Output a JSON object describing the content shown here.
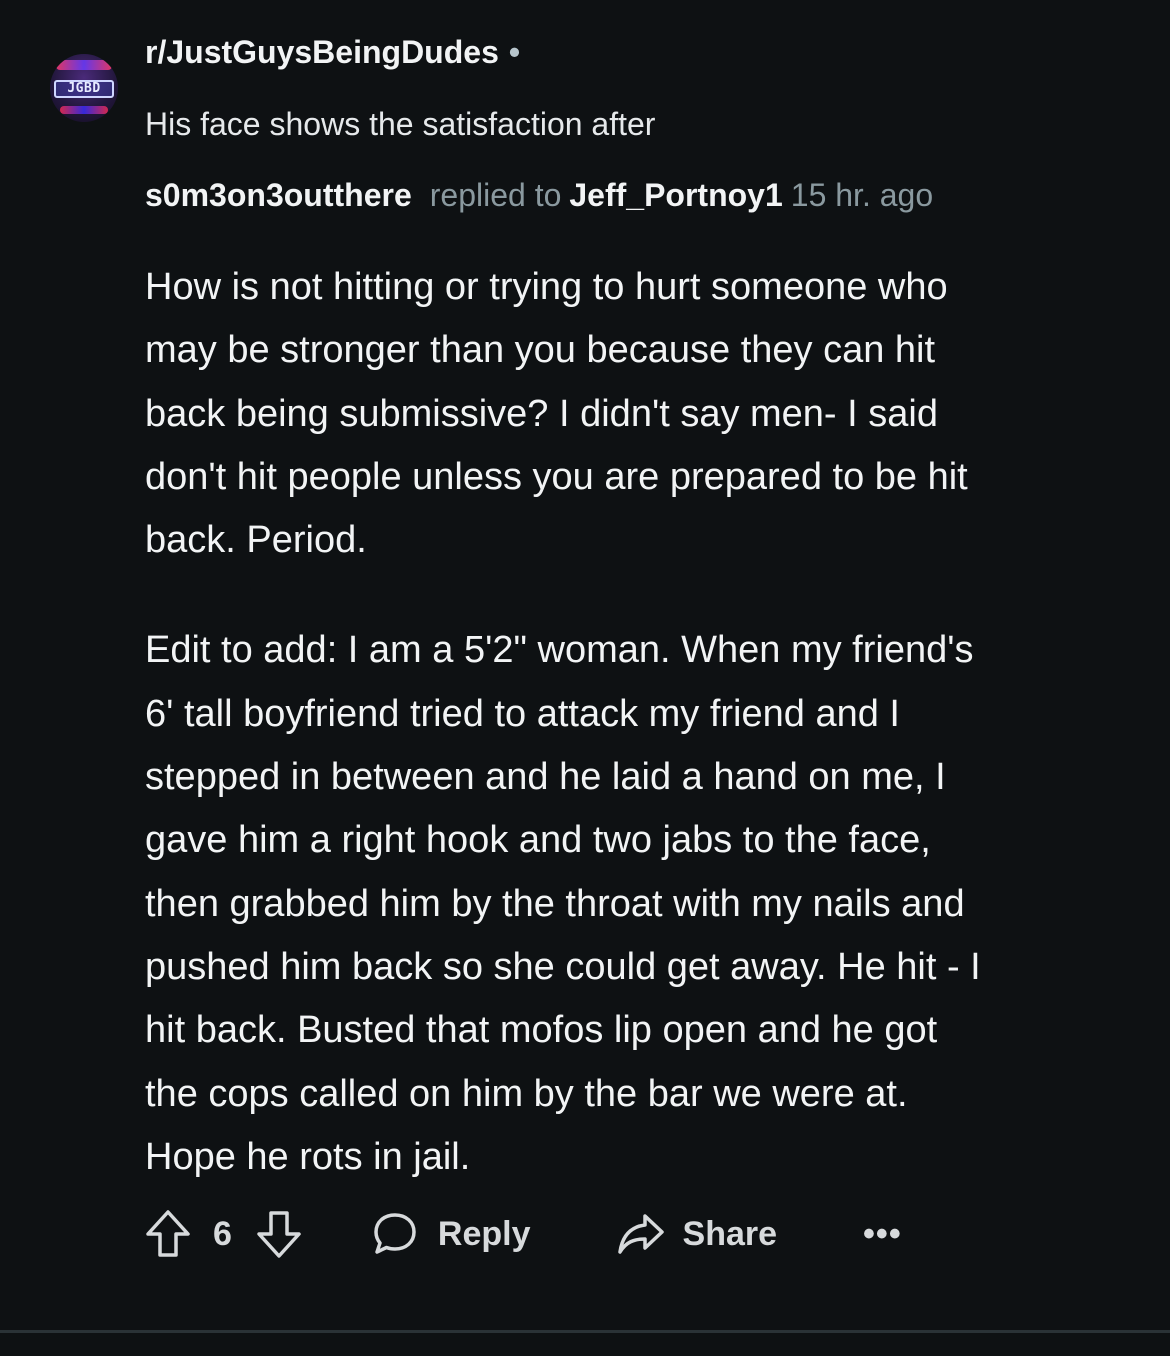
{
  "header": {
    "subreddit": "r/JustGuysBeingDudes",
    "separator": "•",
    "avatar_text": "JGBD",
    "post_title": "His face shows the satisfaction after"
  },
  "comment": {
    "author": "s0m3on3outthere",
    "replied_label": "replied to",
    "parent_author": "Jeff_Portnoy1",
    "time": "15 hr. ago",
    "paragraph1": [
      "How is not hitting or trying to hurt someone who",
      "may be stronger than you because they can hit",
      "back being submissive? I didn't say men- I said",
      "don't hit people unless you are prepared to be hit",
      "back. Period."
    ],
    "paragraph2": [
      "Edit to add: I am a 5'2\" woman. When my friend's",
      "6' tall boyfriend tried to attack my friend and I",
      "stepped in between and he laid a hand on me, I",
      "gave him a right hook and two jabs to the face,",
      "then grabbed him by the throat with my nails and",
      "pushed him back so she could get away. He hit - I",
      "hit back. Busted that mofos lip open and he got",
      "the cops called on him by the bar we were at.",
      "Hope he rots in jail."
    ]
  },
  "actions": {
    "upvote_icon": "arrow-up-icon",
    "vote_count": "6",
    "downvote_icon": "arrow-down-icon",
    "reply_icon": "speech-bubble-icon",
    "reply_label": "Reply",
    "share_icon": "share-arrow-icon",
    "share_label": "Share",
    "more_label": "•••"
  },
  "colors": {
    "background": "#0e1113",
    "text_primary": "#f2f4f5",
    "text_muted": "#8a999f",
    "divider": "#2a3236"
  }
}
